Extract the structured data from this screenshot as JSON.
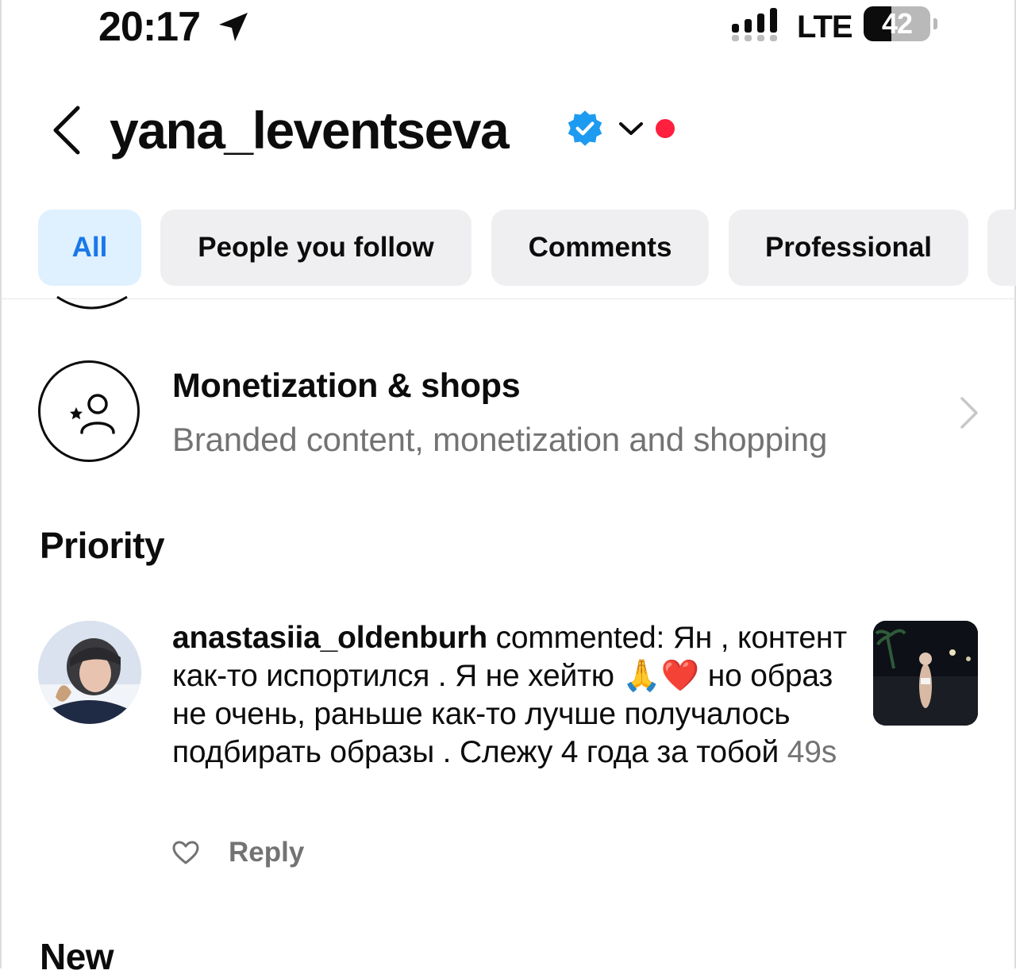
{
  "status_bar": {
    "time": "20:17",
    "network": "LTE",
    "battery": "42",
    "battery_level": 0.42,
    "icons": [
      "location-arrow-icon",
      "signal-icon",
      "battery-icon"
    ]
  },
  "header": {
    "account_name": "yana_leventseva",
    "icons": [
      "chevron-left-icon",
      "verified-badge-icon",
      "chevron-down-icon",
      "notification-dot"
    ]
  },
  "filters": {
    "chips": [
      {
        "label": "All",
        "active": true
      },
      {
        "label": "People you follow",
        "active": false
      },
      {
        "label": "Comments",
        "active": false
      },
      {
        "label": "Professional",
        "active": false
      }
    ]
  },
  "monetization": {
    "title": "Monetization & shops",
    "subtitle": "Branded content, monetization and shopping",
    "icon": "person-star-icon"
  },
  "priority": {
    "heading": "Priority",
    "comment": {
      "username": "anastasiia_oldenburh",
      "text_before_emoji": " commented: Ян , контент как-то испортился . Я не хейтю ",
      "emoji": "🙏❤️",
      "text_after_emoji": " но образ не очень, раньше как-то лучше получалось подбирать образы . Слежу 4 года за тобой ",
      "time": "49s",
      "reply_label": "Reply"
    }
  },
  "new_section": {
    "heading": "New"
  },
  "colors": {
    "accent_blue": "#1a78e6",
    "active_chip_bg": "#dff0ff",
    "chip_bg": "#efeff1",
    "secondary_text": "#737373",
    "verified_blue": "#1d9bf0",
    "notification_red": "#ff1f3e"
  }
}
